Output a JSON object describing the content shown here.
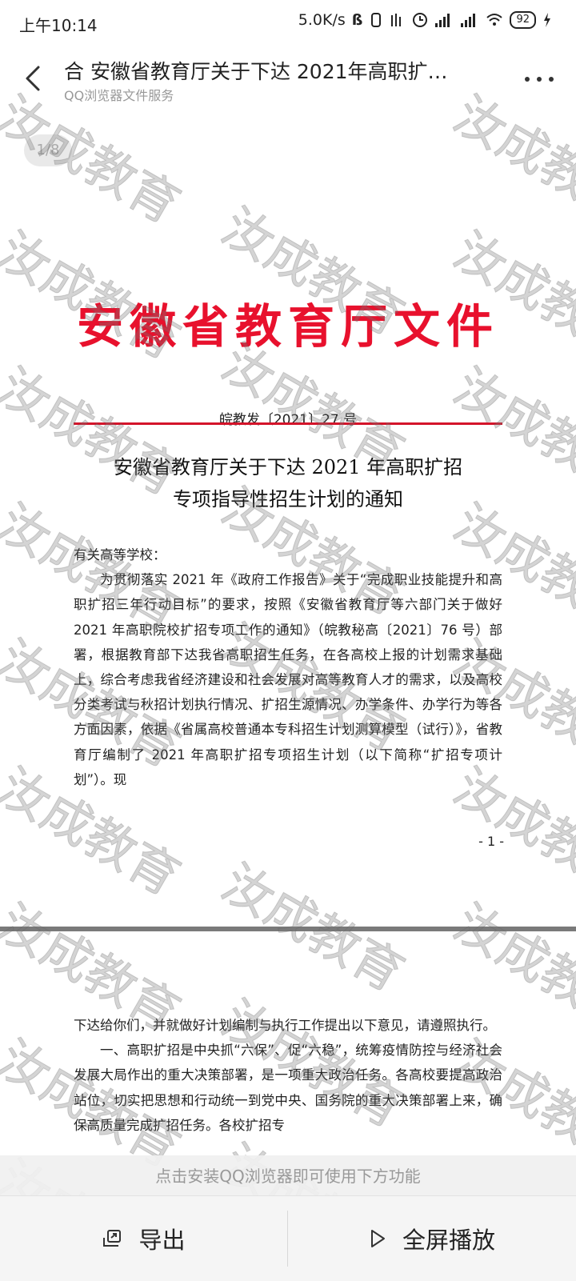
{
  "status_bar": {
    "time": "上午10:14",
    "speed": "5.0K/s",
    "battery": "92"
  },
  "header": {
    "title": "合  安徽省教育厅关于下达 2021年高职扩…",
    "subtitle": "QQ浏览器文件服务"
  },
  "pager": {
    "label": "1/8"
  },
  "document": {
    "red_header": "安徽省教育厅文件",
    "doc_number": "皖教发〔2021〕27 号",
    "title_line1": "安徽省教育厅关于下达 2021 年高职扩招",
    "title_line2": "专项指导性招生计划的通知",
    "salutation": "有关高等学校：",
    "para1": "为贯彻落实 2021 年《政府工作报告》关于“完成职业技能提升和高职扩招三年行动目标”的要求，按照《安徽省教育厅等六部门关于做好 2021 年高职院校扩招专项工作的通知》（皖教秘高〔2021〕76 号）部署，根据教育部下达我省高职招生任务，在各高校上报的计划需求基础上，综合考虑我省经济建设和社会发展对高等教育人才的需求，以及高校分类考试与秋招计划执行情况、扩招生源情况、办学条件、办学行为等各方面因素，依据《省属高校普通本专科招生计划测算模型（试行）》，省教育厅编制了 2021 年高职扩招专项招生计划（以下简称“扩招专项计划”）。现",
    "page_number": "- 1 -",
    "page2_para0": "下达给你们，并就做好计划编制与执行工作提出以下意见，请遵照执行。",
    "page2_para1": "一、高职扩招是中央抓“六保”、促“六稳”，统筹疫情防控与经济社会发展大局作出的重大决策部署，是一项重大政治任务。各高校要提高政治站位，切实把思想和行动统一到党中央、国务院的重大决策部署上来，确保高质量完成扩招任务。各校扩招专"
  },
  "watermark": {
    "text": "汝成教育"
  },
  "bottom_bar": {
    "hint": "点击安装QQ浏览器即可使用下方功能",
    "export_label": "导出",
    "fullscreen_label": "全屏播放"
  }
}
